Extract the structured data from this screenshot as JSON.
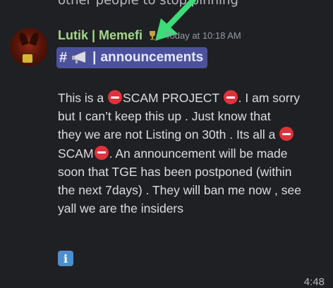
{
  "previous_message": {
    "text": "other people to stop pinning"
  },
  "message": {
    "author": "Lutik | Memefi",
    "timestamp": "Today at 10:18 AM",
    "role_icon": "trophy-icon",
    "channel_mention": {
      "hash": "#",
      "icon": "megaphone-icon",
      "separator": "|",
      "name": "announcements"
    },
    "lines": [
      {
        "a": "This is a ",
        "b": "SCAM PROJECT ",
        "c": ". I am sorry"
      },
      {
        "a": "but I can’t  keep this up . Just know that"
      },
      {
        "a": "they we are not Listing on 30th . Its all a "
      },
      {
        "a": "SCAM",
        "b": ". An announcement will be made"
      },
      {
        "a": "soon that TGE has been postponed (within"
      },
      {
        "a": "the next 7days) . They will ban  me now , see"
      },
      {
        "a": "yall we are the  insiders"
      }
    ],
    "attachment_emoji": "information-icon",
    "emoji_name": "no-entry-icon"
  },
  "footer": {
    "time": "4:48"
  },
  "colors": {
    "background": "#1f2023",
    "username": "#a4d88a",
    "mention_bg": "#4c519d",
    "no_entry": "#e0323c",
    "arrow": "#3ddb7a"
  }
}
